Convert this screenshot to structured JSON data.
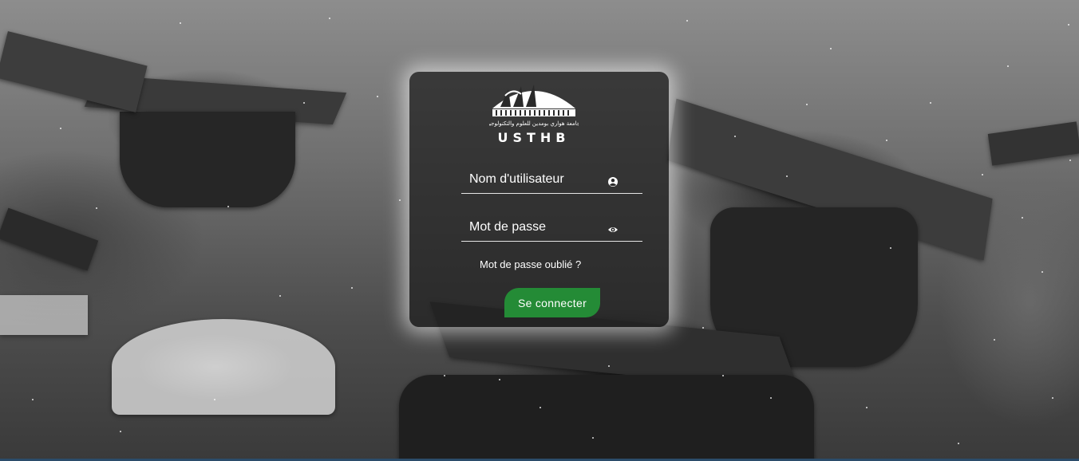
{
  "login": {
    "logo_arabic": "جامعة هواري بومدين للعلوم والتكنولوجيا",
    "logo_text": "USTHB",
    "username_placeholder": "Nom d'utilisateur",
    "username_icon": "user-circle-icon",
    "password_placeholder": "Mot de passe",
    "password_icon": "eye-icon",
    "forgot_password": "Mot de passe oublié ?",
    "submit_label": "Se connecter"
  },
  "colors": {
    "button": "#248b36",
    "card": "#1e1e1e",
    "text": "#ffffff"
  }
}
